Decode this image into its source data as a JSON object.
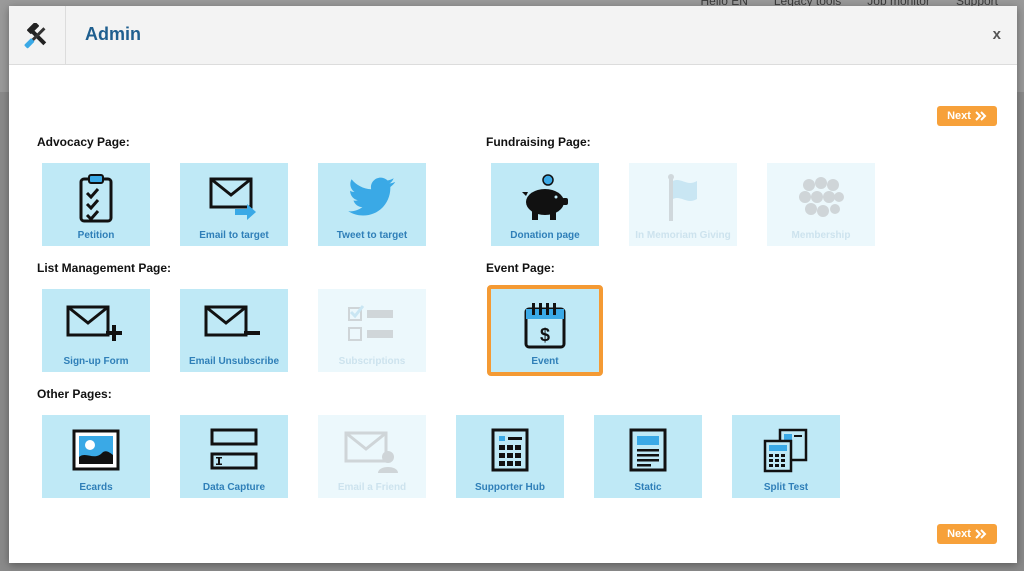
{
  "background": {
    "links": [
      "Hello EN",
      "Legacy tools",
      "Job monitor",
      "Support"
    ]
  },
  "modal": {
    "title": "Admin",
    "close_label": "x",
    "next_label": "Next"
  },
  "sections": {
    "advocacy": "Advocacy Page:",
    "fundraising": "Fundraising Page:",
    "list_management": "List Management Page:",
    "event": "Event Page:",
    "other": "Other Pages:"
  },
  "tiles": {
    "petition": {
      "label": "Petition",
      "icon": "clipboard-check-icon",
      "enabled": true
    },
    "email_target": {
      "label": "Email to target",
      "icon": "envelope-arrow-icon",
      "enabled": true
    },
    "tweet_target": {
      "label": "Tweet to target",
      "icon": "twitter-bird-icon",
      "enabled": true
    },
    "donation": {
      "label": "Donation page",
      "icon": "piggy-bank-icon",
      "enabled": true
    },
    "memoriam": {
      "label": "In Memoriam Giving",
      "icon": "flag-icon",
      "enabled": false
    },
    "membership": {
      "label": "Membership",
      "icon": "people-group-icon",
      "enabled": false
    },
    "signup": {
      "label": "Sign-up Form",
      "icon": "envelope-plus-icon",
      "enabled": true
    },
    "unsubscribe": {
      "label": "Email Unsubscribe",
      "icon": "envelope-minus-icon",
      "enabled": true
    },
    "subscriptions": {
      "label": "Subscriptions",
      "icon": "checklist-icon",
      "enabled": false
    },
    "event": {
      "label": "Event",
      "icon": "calendar-dollar-icon",
      "enabled": true,
      "selected": true
    },
    "ecards": {
      "label": "Ecards",
      "icon": "picture-icon",
      "enabled": true
    },
    "data_capture": {
      "label": "Data Capture",
      "icon": "form-fields-icon",
      "enabled": true
    },
    "email_friend": {
      "label": "Email a Friend",
      "icon": "envelope-person-icon",
      "enabled": false
    },
    "supporter_hub": {
      "label": "Supporter Hub",
      "icon": "grid-document-icon",
      "enabled": true
    },
    "static": {
      "label": "Static",
      "icon": "static-page-icon",
      "enabled": true
    },
    "split_test": {
      "label": "Split Test",
      "icon": "split-pages-icon",
      "enabled": true
    }
  },
  "colors": {
    "accent": "#f7a13a",
    "tile": "#bfe9f6",
    "tile_disabled": "#ecf8fc",
    "label": "#2f7fb8",
    "title": "#1f5f8f",
    "twitter": "#3aa9e6"
  }
}
